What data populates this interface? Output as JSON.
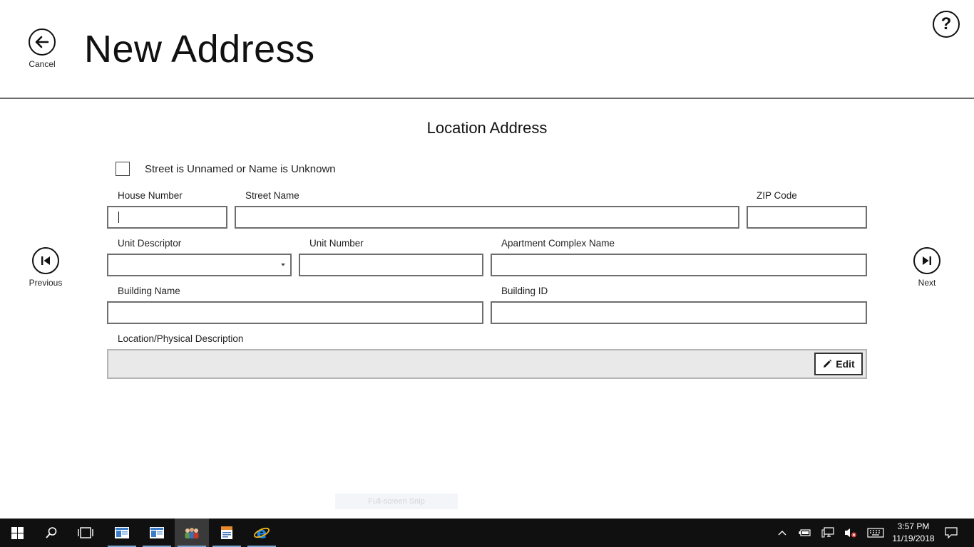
{
  "header": {
    "title": "New Address",
    "cancel_label": "Cancel",
    "help_symbol": "?"
  },
  "section_title": "Location Address",
  "checkbox": {
    "label": "Street is Unnamed or Name is Unknown",
    "checked": false
  },
  "fields": {
    "house_number": {
      "label": "House Number",
      "value": ""
    },
    "street_name": {
      "label": "Street Name",
      "value": ""
    },
    "zip_code": {
      "label": "ZIP Code",
      "value": ""
    },
    "unit_descriptor": {
      "label": "Unit Descriptor",
      "value": ""
    },
    "unit_number": {
      "label": "Unit Number",
      "value": ""
    },
    "apartment_complex_name": {
      "label": "Apartment Complex Name",
      "value": ""
    },
    "building_name": {
      "label": "Building Name",
      "value": ""
    },
    "building_id": {
      "label": "Building ID",
      "value": ""
    },
    "location_description": {
      "label": "Location/Physical Description",
      "value": ""
    }
  },
  "edit_label": "Edit",
  "nav": {
    "previous_label": "Previous",
    "next_label": "Next"
  },
  "snip_overlay": "Full-screen Snip",
  "taskbar": {
    "icons": [
      "windows-start-icon",
      "search-icon",
      "task-view-icon",
      "app-window-icon",
      "app-window-icon",
      "people-app-icon",
      "document-app-icon",
      "internet-explorer-icon"
    ],
    "time": "3:57 PM",
    "date": "11/19/2018"
  },
  "colors": {
    "taskbar": "#101010",
    "accent": "#7aa7d6",
    "ie_blue": "#1e88e5",
    "ie_gold": "#f2b51c"
  }
}
